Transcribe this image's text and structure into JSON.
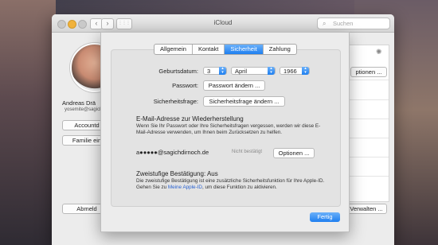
{
  "window": {
    "title": "iCloud",
    "search_placeholder": "Suchen",
    "back_glyph": "‹",
    "forward_glyph": "›",
    "grid_glyph": "⋮⋮⋮",
    "search_glyph": "⌕"
  },
  "account": {
    "name": "Andreas Drä",
    "email": "yosemite@sagich",
    "details_button": "Accountd",
    "family_button": "Familie ein",
    "signout_button": "Abmeld",
    "options_button": "ptionen ...",
    "manage_button": "Verwalten ..."
  },
  "sheet": {
    "tabs": [
      {
        "label": "Allgemein",
        "active": false
      },
      {
        "label": "Kontakt",
        "active": false
      },
      {
        "label": "Sicherheit",
        "active": true
      },
      {
        "label": "Zahlung",
        "active": false
      }
    ],
    "birthdate_label": "Geburtsdatum:",
    "birth_day": "3",
    "birth_month": "April",
    "birth_year": "1966",
    "password_label": "Passwort:",
    "password_button": "Passwort ändern ...",
    "security_label": "Sicherheitsfrage:",
    "security_button": "Sicherheitsfrage ändern ...",
    "rescue_heading": "E-Mail-Adresse zur Wiederherstellung",
    "rescue_text": "Wenn Sie Ihr Passwort oder Ihre Sicherheitsfragen vergessen, werden wir diese E-Mail-Adresse verwenden, um Ihnen beim Zurücksetzen zu helfen.",
    "rescue_email": "a●●●●●@sagichdirnoch.de",
    "rescue_status": "Nicht bestätigt",
    "rescue_options_button": "Optionen ...",
    "twostep_heading": "Zweistufige Bestätigung: Aus",
    "twostep_text_1": "Die zweistufige Bestätigung ist eine zusätzliche Sicherheitsfunktion für Ihre Apple-ID. Gehen Sie zu ",
    "twostep_link": "Meine Apple-ID",
    "twostep_text_2": ", um diese Funktion zu aktivieren.",
    "done_button": "Fertig"
  },
  "colors": {
    "accent": "#1e7ff0",
    "link": "#2a62d0",
    "minimize": "#f1b23b"
  }
}
